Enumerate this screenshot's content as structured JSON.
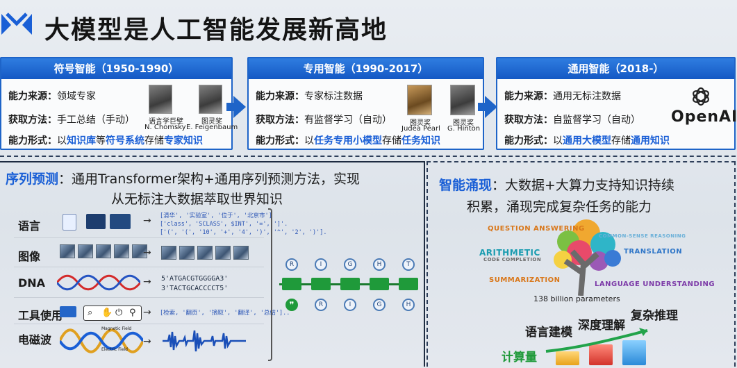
{
  "slide": {
    "title": "大模型是人工智能发展新高地",
    "logo": "m-logo-icon"
  },
  "panels": [
    {
      "head": "符号智能（1950-1990）",
      "source_k": "能力来源：",
      "source_v": "领域专家",
      "method_k": "获取方法：",
      "method_v": "手工总结（手动）",
      "form_k": "能力形式：",
      "form_a": "以",
      "form_b": "知识库",
      "form_c": "等",
      "form_d": "符号系统",
      "form_e": "存储",
      "form_f": "专家知识",
      "people": [
        {
          "cap1": "语言学巨擘",
          "cap2": "N. Chomsky"
        },
        {
          "cap1": "图灵奖",
          "cap2": "E. Feigenbaum"
        }
      ]
    },
    {
      "head": "专用智能（1990-2017）",
      "source_k": "能力来源：",
      "source_v": "专家标注数据",
      "method_k": "获取方法：",
      "method_v": "有监督学习（自动）",
      "form_k": "能力形式：",
      "form_a": "以",
      "form_b": "任务专用小模型",
      "form_c": "存储",
      "form_d": "任务知识",
      "people": [
        {
          "cap1": "图灵奖",
          "cap2": "Judea Pearl"
        },
        {
          "cap1": "图灵奖",
          "cap2": "G. Hinton"
        }
      ]
    },
    {
      "head": "通用智能（2018-）",
      "source_k": "能力来源：",
      "source_v": "通用无标注数据",
      "method_k": "获取方法：",
      "method_v": "自监督学习（自动）",
      "form_k": "能力形式：",
      "form_a": "以",
      "form_b": "通用大模型",
      "form_c": "存储",
      "form_d": "通用知识",
      "brand": "OpenAI"
    }
  ],
  "seq": {
    "title_a": "序列预测",
    "title_b": "：通用Transformer架构+通用序列预测方法，实现",
    "title_c": "从无标注大数据萃取世界知识",
    "modalities": [
      "语言",
      "图像",
      "DNA",
      "工具使用",
      "电磁波"
    ],
    "lang_lines": [
      "[清华', '实验室', '位于', '北京市']",
      "['class', 'SCLASS', $INT', '=', ']'.",
      "['(', '(', '10', '+', '4', ')', '^', '2', ')']."
    ],
    "dna_lines": [
      "5'ATGACGTGGGGA3'",
      "3'TACTGCACCCCT5'"
    ],
    "tool_line": "[检索, '翻页', '摘取', '翻译', '总结']..",
    "wave_labels": [
      "Magnetic Field",
      "Electric Field"
    ],
    "chain_top": [
      "R",
      "I",
      "G",
      "H",
      "T"
    ],
    "chain_bottom": [
      "R",
      "I",
      "G",
      "H"
    ]
  },
  "emergence": {
    "title_a": "智能涌现",
    "title_b": "：大数据+大算力支持知识持续",
    "title_c": "积累，涌现完成复杂任务的能力",
    "tree_labels": {
      "qa": "QUESTION ANSWERING",
      "csr": "COMMON-SENSE REASONING",
      "arith": "ARITHMETIC",
      "code": "CODE COMPLETION",
      "trans": "TRANSLATION",
      "summ": "SUMMARIZATION",
      "lu": "LANGUAGE UNDERSTANDING"
    },
    "params": "138 billion parameters",
    "bar_labels": [
      "计算量",
      "语言建模",
      "深度理解",
      "复杂推理"
    ]
  },
  "colors": {
    "accent": "#1a5fd6",
    "panel_head": "#1458c4",
    "green": "#1f9a3a"
  }
}
